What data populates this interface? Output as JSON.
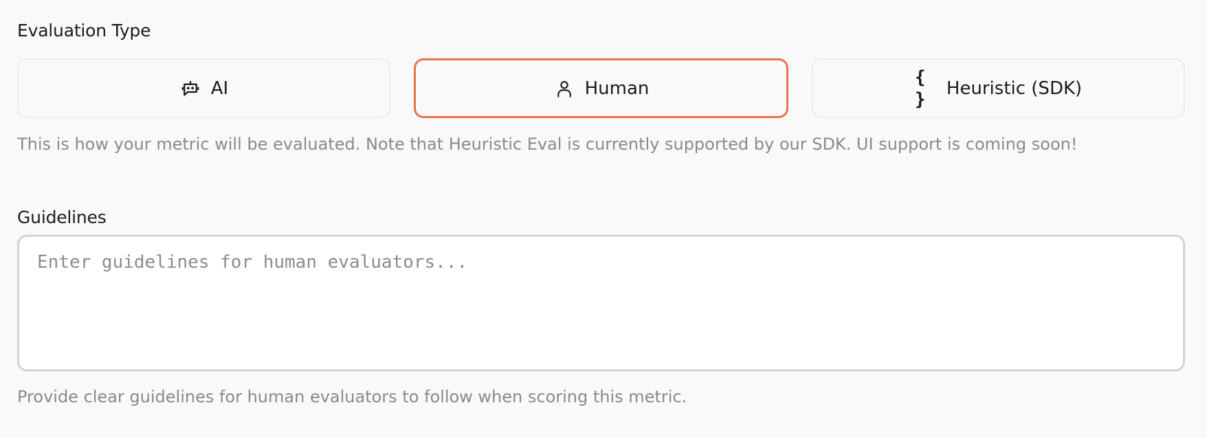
{
  "evaluation_type": {
    "label": "Evaluation Type",
    "options": [
      {
        "label": "AI",
        "icon": "bot-icon",
        "selected": false
      },
      {
        "label": "Human",
        "icon": "user-icon",
        "selected": true
      },
      {
        "label": "Heuristic (SDK)",
        "icon": "braces-icon",
        "glyph": "{ }",
        "selected": false
      }
    ],
    "help_text": "This is how your metric will be evaluated. Note that Heuristic Eval is currently supported by our SDK. UI support is coming soon!"
  },
  "guidelines": {
    "label": "Guidelines",
    "value": "",
    "placeholder": "Enter guidelines for human evaluators...",
    "help_text": "Provide clear guidelines for human evaluators to follow when scoring this metric."
  },
  "colors": {
    "selected_border": "#e8734a",
    "background": "#f9f9f9",
    "muted_text": "#8a8a8a"
  }
}
